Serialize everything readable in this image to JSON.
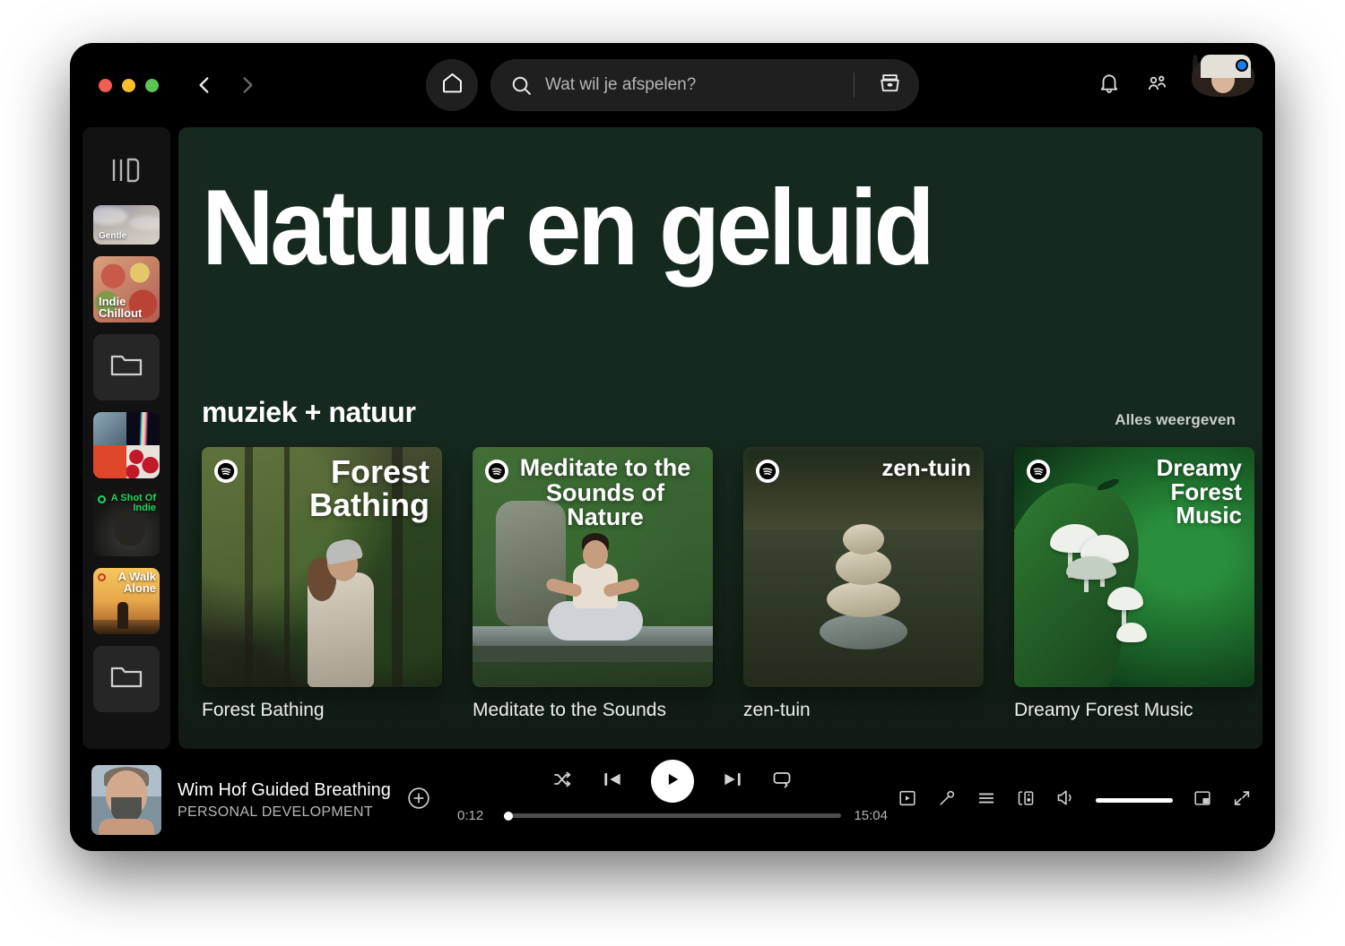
{
  "window": {
    "traffic_lights": [
      "close",
      "minimize",
      "maximize"
    ],
    "back_label": "Vorige",
    "forward_label": "Volgende"
  },
  "topbar": {
    "home_icon": "home-icon",
    "search_placeholder": "Wat wil je afspelen?",
    "search_value": "",
    "search_icon": "search-icon",
    "browse_icon": "browse-icon",
    "notifications_icon": "bell-icon",
    "friends_icon": "friends-icon",
    "avatar_icon": "avatar",
    "avatar_badge": "blue-dot"
  },
  "sidebar": {
    "library_icon": "your-library-icon",
    "items": [
      {
        "name": "gentle",
        "label": "Gentle",
        "type": "playlist",
        "art": "gentle",
        "label_size": "10px"
      },
      {
        "name": "indie-chillout",
        "label": "Indie\nChillout",
        "type": "playlist",
        "art": "indie",
        "label_size": "13px"
      },
      {
        "name": "folder-1",
        "label": "",
        "type": "folder",
        "art": "folder"
      },
      {
        "name": "collage",
        "label": "",
        "type": "playlist",
        "art": "collage"
      },
      {
        "name": "a-shot-of-indie",
        "label": "A Shot Of\nIndie",
        "type": "playlist",
        "art": "shot",
        "label_size": "11px",
        "label_color": "#1ed760",
        "align": "right"
      },
      {
        "name": "a-walk-alone",
        "label": "A Walk\nAlone",
        "type": "playlist",
        "art": "walk",
        "label_size": "13px",
        "label_color": "#ffffff",
        "align": "right"
      },
      {
        "name": "folder-2",
        "label": "",
        "type": "folder",
        "art": "folder"
      }
    ]
  },
  "main": {
    "hero_title": "Natuur en geluid",
    "section": {
      "title": "muziek + natuur",
      "see_all": "Alles weergeven"
    },
    "cards": [
      {
        "name": "forest-bathing",
        "art_title": "Forest\nBathing",
        "label": "Forest Bathing",
        "art": "forest",
        "art_title_size": "36px",
        "art_title_align": "right",
        "badge": "spotify-logo"
      },
      {
        "name": "meditate-to-the-sounds-of-nature",
        "art_title": "Meditate to the\nSounds of Nature",
        "label": "Meditate to the Sounds",
        "art": "meditate",
        "art_title_size": "27px",
        "art_title_align": "center",
        "badge": "spotify-logo"
      },
      {
        "name": "zen-tuin",
        "art_title": "zen-tuin",
        "label": "zen-tuin",
        "art": "zen",
        "art_title_size": "26px",
        "art_title_align": "right",
        "badge": "spotify-logo"
      },
      {
        "name": "dreamy-forest-music",
        "art_title": "Dreamy\nForest\nMusic",
        "label": "Dreamy Forest Music",
        "art": "dreamy",
        "art_title_size": "26px",
        "art_title_align": "right",
        "badge": "spotify-logo"
      }
    ]
  },
  "player": {
    "now_playing": {
      "title": "Wim Hof Guided Breathing",
      "subtitle": "PERSONAL DEVELOPMENT",
      "art": "wim-hof-portrait",
      "add_icon": "add-to-library-icon"
    },
    "controls": {
      "shuffle_icon": "shuffle-icon",
      "previous_icon": "previous-icon",
      "play_icon": "play-icon",
      "next_icon": "next-icon",
      "repeat_icon": "repeat-icon"
    },
    "progress": {
      "elapsed": "0:12",
      "duration": "15:04",
      "percent": 1.3
    },
    "right_controls": {
      "now_playing_view_icon": "now-playing-view-icon",
      "lyrics_icon": "microphone-icon",
      "queue_icon": "queue-icon",
      "connect_device_icon": "connect-to-device-icon",
      "volume_icon": "volume-icon",
      "volume_percent": 100,
      "miniplayer_icon": "miniplayer-icon",
      "fullscreen_icon": "fullscreen-icon"
    }
  },
  "colors": {
    "accent_green": "#1ed760",
    "hero_bg": "#16291f",
    "app_bg": "#000000",
    "panel_bg": "#121212",
    "badge_blue": "#1a7df0"
  }
}
